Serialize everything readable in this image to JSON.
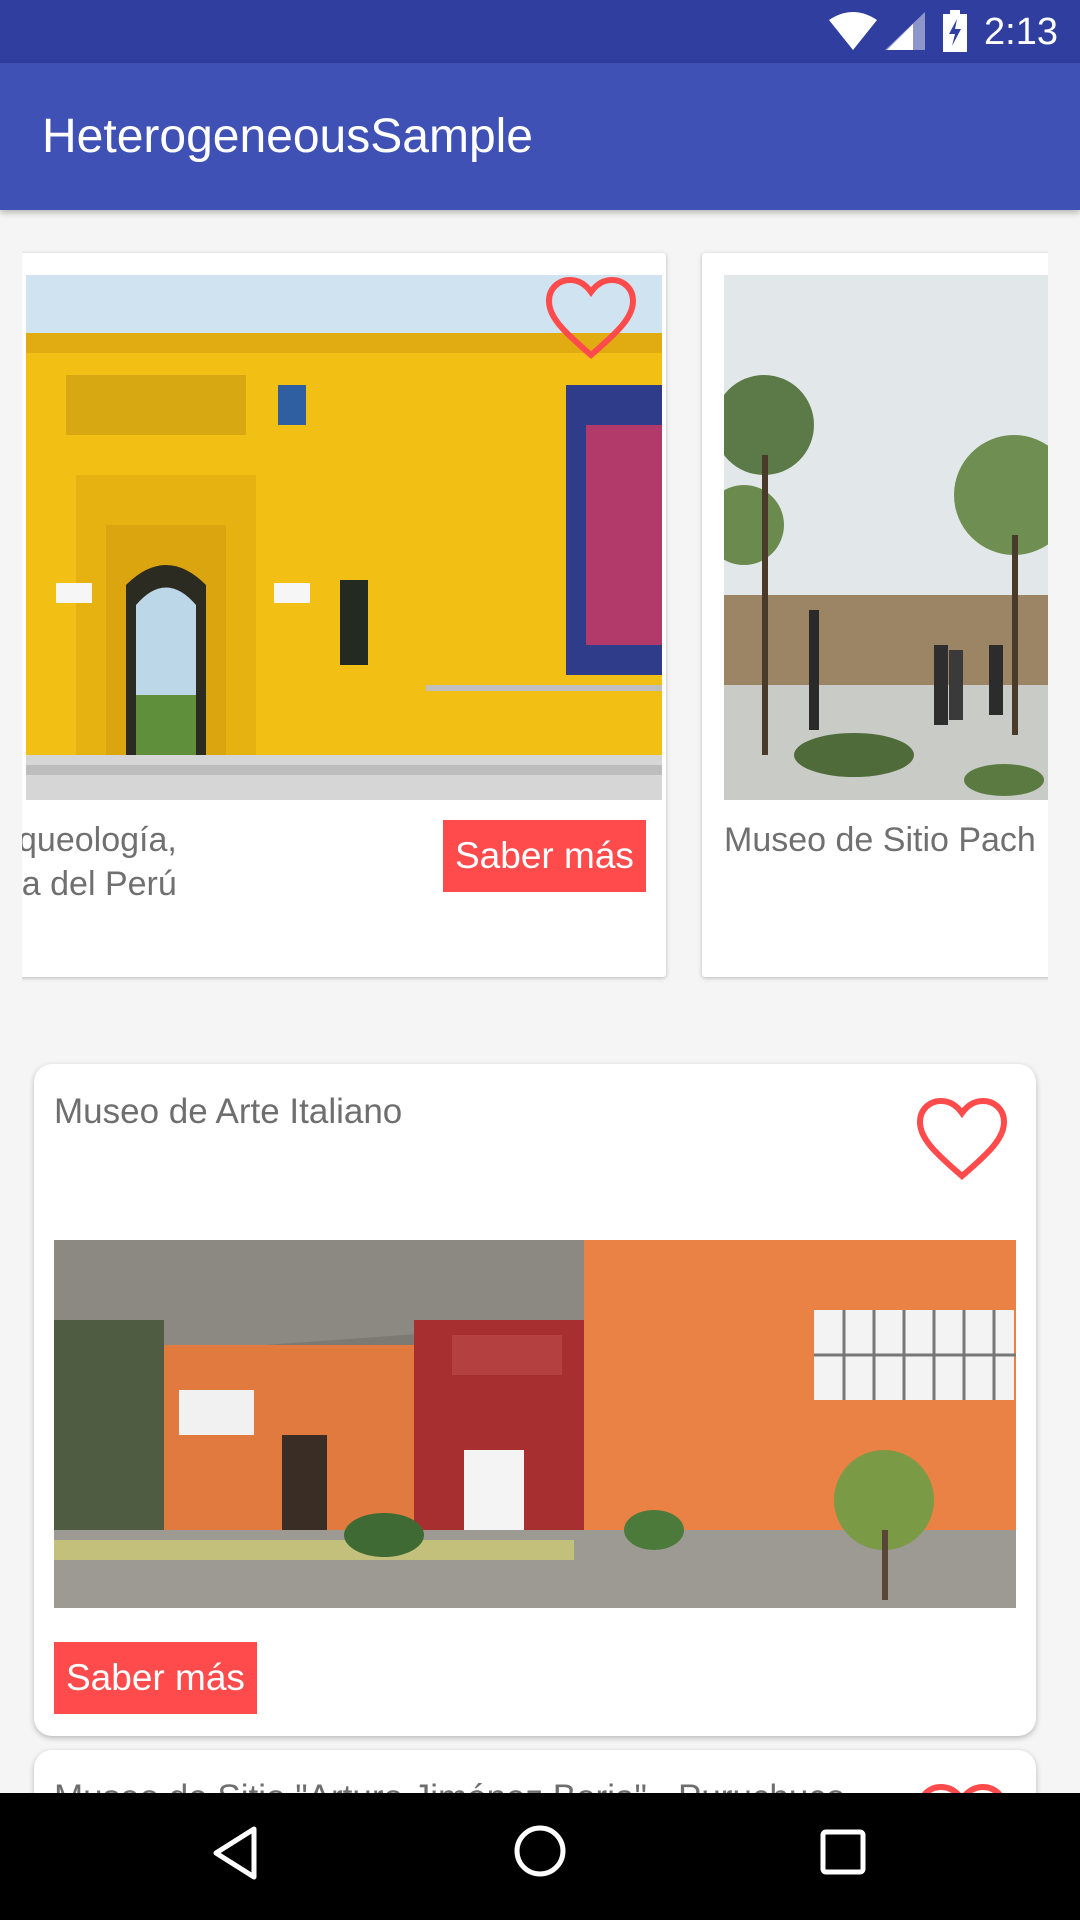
{
  "status_bar": {
    "time": "2:13",
    "icons": [
      "wifi-icon",
      "signal-icon",
      "battery-charging-icon"
    ]
  },
  "app_bar": {
    "title": "HeterogeneousSample"
  },
  "carousel": {
    "cards": [
      {
        "title_line1": "Arqueología,",
        "title_line2": "oria del Perú",
        "button_label": "Saber más",
        "favorite_icon": "heart-outline-icon"
      },
      {
        "title_line1": "Museo de Sitio Pach",
        "title_line2": ""
      }
    ]
  },
  "list": {
    "cards": [
      {
        "title": "Museo de Arte Italiano",
        "button_label": "Saber más",
        "favorite_icon": "heart-outline-icon"
      },
      {
        "title": "Museo de Sitio \"Arturo Jiménez Borja\" - Puruchuco",
        "favorite_icon": "heart-outline-icon"
      }
    ]
  },
  "colors": {
    "status_bar": "#303f9f",
    "app_bar": "#3f51b5",
    "accent": "#ff4b4b",
    "background": "#f5f5f5"
  },
  "nav_bar": {
    "icons": [
      "back-icon",
      "home-icon",
      "recent-apps-icon"
    ]
  }
}
